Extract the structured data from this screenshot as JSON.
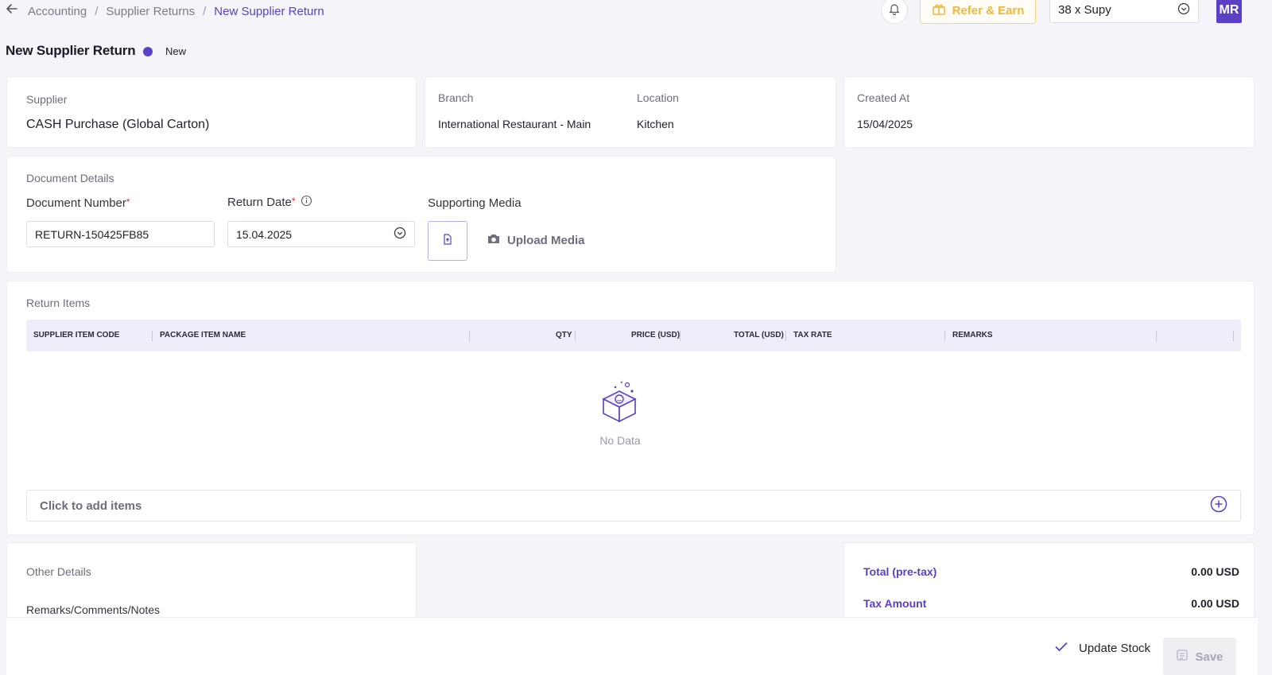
{
  "breadcrumb": {
    "items": [
      "Accounting",
      "Supplier Returns",
      "New Supplier Return"
    ]
  },
  "topbar": {
    "refer_label": "Refer & Earn",
    "company_selected": "38 x Supy",
    "avatar_initials": "MR"
  },
  "page": {
    "title": "New Supplier Return",
    "status": "New"
  },
  "supplier_card": {
    "label": "Supplier",
    "value": "CASH Purchase (Global Carton)"
  },
  "branch_card": {
    "branch_label": "Branch",
    "branch_value": "International Restaurant - Main",
    "location_label": "Location",
    "location_value": "Kitchen"
  },
  "created_card": {
    "label": "Created At",
    "value": "15/04/2025"
  },
  "document_details": {
    "section_title": "Document Details",
    "doc_number_label": "Document Number",
    "doc_number_value": "RETURN-150425FB85",
    "return_date_label": "Return Date",
    "return_date_value": "15.04.2025",
    "supporting_media_label": "Supporting Media",
    "upload_media_label": "Upload Media"
  },
  "return_items": {
    "section_title": "Return Items",
    "columns": [
      "SUPPLIER ITEM CODE",
      "PACKAGE ITEM NAME",
      "QTY",
      "PRICE (USD)",
      "TOTAL (USD)",
      "TAX RATE",
      "REMARKS"
    ],
    "empty_text": "No Data",
    "add_items_label": "Click to add items"
  },
  "other_details": {
    "section_title": "Other Details",
    "remarks_label": "Remarks/Comments/Notes"
  },
  "totals": {
    "pre_tax_label": "Total (pre-tax)",
    "pre_tax_value": "0.00 USD",
    "tax_label": "Tax Amount",
    "tax_value": "0.00 USD"
  },
  "footer": {
    "update_stock_label": "Update Stock",
    "update_stock_checked": true,
    "save_label": "Save"
  },
  "colors": {
    "accent": "#5b3fc4",
    "refer": "#f0b73a",
    "required": "#d92b2b"
  }
}
